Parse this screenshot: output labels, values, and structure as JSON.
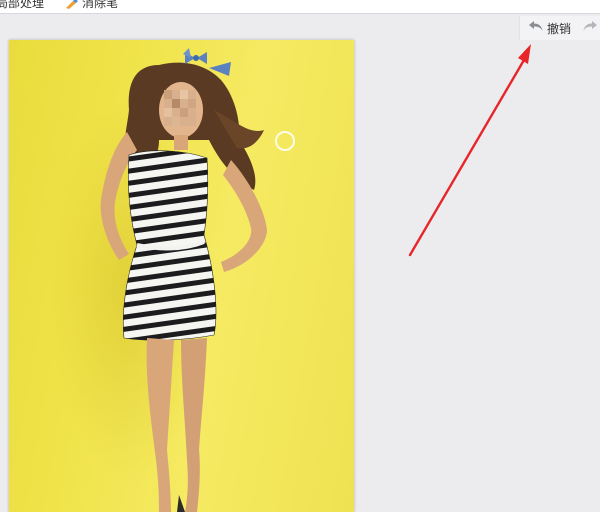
{
  "topbar": {
    "item1_label": "局部处理",
    "item2_label": "消除笔"
  },
  "toolbar": {
    "undo_label": "撤销",
    "undo_icon": "undo-arrow-icon",
    "redo_icon": "redo-arrow-icon"
  },
  "canvas": {
    "content": "photo-of-woman-in-striped-dress",
    "brush_cursor_icon": "circle-cursor-icon"
  },
  "annotation": {
    "color": "#e8262a"
  },
  "colors": {
    "background": "#ececee",
    "photo_background": "#f0e34a"
  }
}
